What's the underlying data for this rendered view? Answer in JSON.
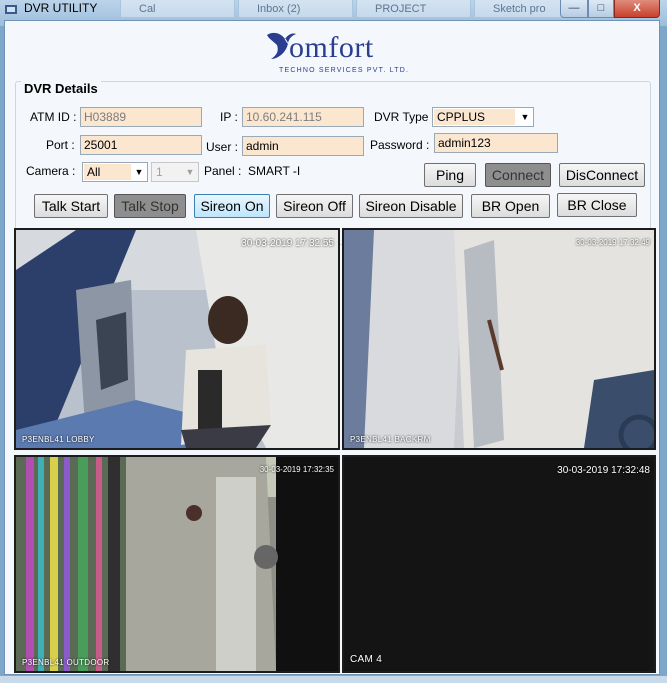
{
  "window": {
    "title": "DVR UTILITY",
    "background_tabs": [
      "Cal",
      "Inbox (2)",
      "PROJECT",
      "Sketch pro"
    ],
    "close_label": "X",
    "min_label": "—",
    "max_label": "□"
  },
  "logo": {
    "name": "Comfort",
    "rest": "omfort",
    "subtitle": "TECHNO SERVICES PVT. LTD."
  },
  "dvr": {
    "group_title": "DVR Details",
    "atm_id_label": "ATM ID :",
    "atm_id": "H03889",
    "ip_label": "IP :",
    "ip": "10.60.241.115",
    "dvr_type_label": "DVR Type :",
    "dvr_type": "CPPLUS",
    "port_label": "Port :",
    "port": "25001",
    "user_label": "User :",
    "user": "admin",
    "password_label": "Password :",
    "password": "admin123",
    "camera_label": "Camera :",
    "camera": "All",
    "channel": "1",
    "panel_label": "Panel :",
    "panel": "SMART -I"
  },
  "buttons": {
    "ping": "Ping",
    "connect": "Connect",
    "disconnect": "DisConnect",
    "talk_start": "Talk Start",
    "talk_stop": "Talk Stop",
    "sireon_on": "Sireon On",
    "sireon_off": "Sireon Off",
    "sireon_disable": "Sireon Disable",
    "br_open": "BR Open",
    "br_close": "BR Close"
  },
  "cameras": [
    {
      "timestamp": "30-03-2019 17:32:55",
      "name": "P3ENBL41 LOBBY"
    },
    {
      "timestamp": "30-03-2019 17:32:49",
      "name": "P3ENBL41 BACKRM"
    },
    {
      "timestamp": "30-03-2019 17:32:35",
      "name": "P3ENBL41 OUTDOOR"
    },
    {
      "timestamp": "30-03-2019 17:32:48",
      "name": "CAM 4"
    }
  ],
  "colors": {
    "field_bg": "#fbe7d0",
    "brand": "#2b3d8f"
  }
}
